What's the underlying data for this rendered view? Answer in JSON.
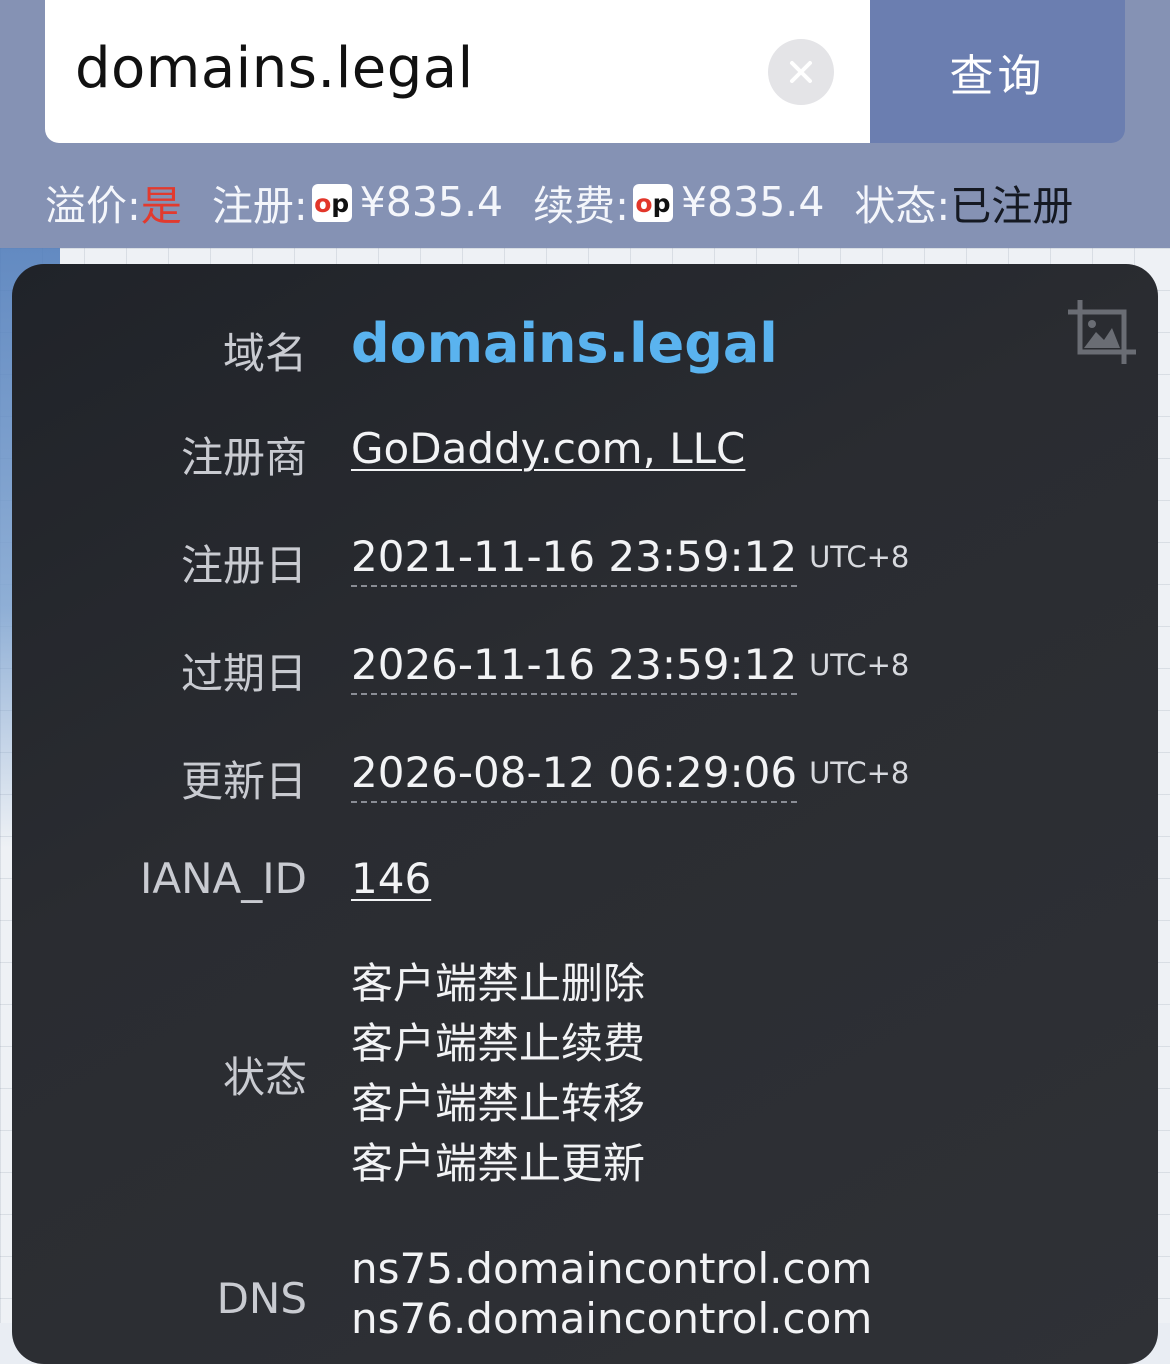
{
  "search": {
    "query": "domains.legal",
    "button_label": "查询"
  },
  "summary": {
    "premium_label": "溢价:",
    "premium_value": "是",
    "register_label": "注册:",
    "register_price": "¥835.4",
    "renew_label": "续费:",
    "renew_price": "¥835.4",
    "status_label": "状态:",
    "status_value": "已注册",
    "badge_o": "o",
    "badge_p": "p"
  },
  "whois": {
    "domain_label": "域名",
    "domain_value": "domains.legal",
    "registrar_label": "注册商",
    "registrar_value": "GoDaddy.com, LLC",
    "created_label": "注册日",
    "created_value": "2021-11-16 23:59:12",
    "expires_label": "过期日",
    "expires_value": "2026-11-16 23:59:12",
    "updated_label": "更新日",
    "updated_value": "2026-08-12 06:29:06",
    "timezone": "UTC+8",
    "iana_label": "IANA_ID",
    "iana_value": "146",
    "status_label": "状态",
    "status_values": [
      "客户端禁止删除",
      "客户端禁止续费",
      "客户端禁止转移",
      "客户端禁止更新"
    ],
    "dns_label": "DNS",
    "dns_values": [
      "ns75.domaincontrol.com",
      "ns76.domaincontrol.com"
    ]
  },
  "colors": {
    "header_bg": "#8592b4",
    "query_button": "#6b7eb0",
    "domain_blue": "#5ab3ef",
    "premium_red": "#e23a2e",
    "card_bg": "#2a2c31"
  },
  "icons": [
    "close-icon",
    "image-crop-icon"
  ]
}
